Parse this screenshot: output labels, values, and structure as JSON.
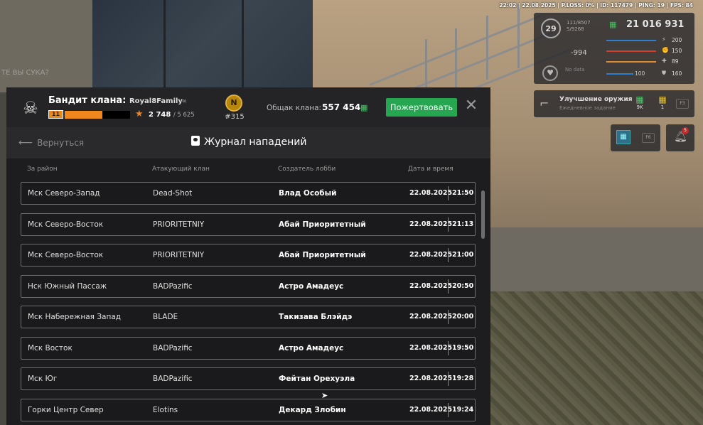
{
  "status_line": "22:02 | 22.08.2025 | P.LOSS: 0% | ID: 117479 | PING: 19 | FPS: 84",
  "ghost_text": "ТЕ ВЫ СУКА?",
  "hud": {
    "level": "29",
    "xp_text": "111/8507 S/9268",
    "cash": "21 016 931",
    "negative_value": "-994",
    "heart_label": "No data",
    "stats": [
      {
        "icon": "energy-icon",
        "glyph": "⚡",
        "value": "200",
        "color": "#2e7fd0"
      },
      {
        "icon": "stamina-icon",
        "glyph": "✊",
        "value": "150",
        "color": "#d0402e"
      },
      {
        "icon": "hunger-icon",
        "glyph": "✚",
        "value": "89",
        "color": "#e08a2a"
      },
      {
        "icon": "armor-icon",
        "glyph": "⛊",
        "value": "160",
        "color": "#2e7fd0",
        "left_value": "100"
      }
    ],
    "weapon": {
      "title": "Улучшение оружия",
      "subtitle": "Ежедневное задание",
      "items": [
        {
          "icon": "cash-icon",
          "glyph": "▦",
          "value": "9K",
          "color": "#4ec46a"
        },
        {
          "icon": "ticket-icon",
          "glyph": "▦",
          "value": "1",
          "color": "#e0c030"
        }
      ],
      "key": "F3"
    },
    "map_key": "F6",
    "bell_badge": "5"
  },
  "header": {
    "rank_label": "Бандит клана:",
    "clan_name": "Royal8Family",
    "level": "11",
    "level_progress": 0.58,
    "reputation": "2 748",
    "reputation_max": "/ 5 625",
    "rank_medal": "N",
    "rank_number": "#315",
    "fund_label": "Общак клана:",
    "fund_value": "557 454",
    "donate_label": "Пожертвовать",
    "close_glyph": "✕"
  },
  "toolbar": {
    "back_label": "Вернуться",
    "title": "Журнал нападений"
  },
  "columns": {
    "district": "За район",
    "attacker": "Атакующий клан",
    "creator": "Создатель лобби",
    "datetime": "Дата и время"
  },
  "rows": [
    {
      "district": "Мск Северо-Запад",
      "attacker": "Dead-Shot",
      "creator": "Влад Особый",
      "date": "22.08.2025",
      "time": "21:50"
    },
    {
      "district": "Мск Северо-Восток",
      "attacker": "PRIORITETNIY",
      "creator": "Абай Приоритетный",
      "date": "22.08.2025",
      "time": "21:13"
    },
    {
      "district": "Мск Северо-Восток",
      "attacker": "PRIORITETNIY",
      "creator": "Абай Приоритетный",
      "date": "22.08.2025",
      "time": "21:00"
    },
    {
      "district": "Нск Южный Пассаж",
      "attacker": "BADPazific",
      "creator": "Астро Амадеус",
      "date": "22.08.2025",
      "time": "20:50"
    },
    {
      "district": "Мск Набережная Запад",
      "attacker": "BLADE",
      "creator": "Такизава Блэйдэ",
      "date": "22.08.2025",
      "time": "20:00"
    },
    {
      "district": "Мск Восток",
      "attacker": "BADPazific",
      "creator": "Астро Амадеус",
      "date": "22.08.2025",
      "time": "19:50"
    },
    {
      "district": "Мск Юг",
      "attacker": "BADPazific",
      "creator": "Фейтан Орехуэла",
      "date": "22.08.2025",
      "time": "19:28"
    },
    {
      "district": "Горки Центр Север",
      "attacker": "Elotins",
      "creator": "Декард Злобин",
      "date": "22.08.2025",
      "time": "19:24"
    }
  ]
}
